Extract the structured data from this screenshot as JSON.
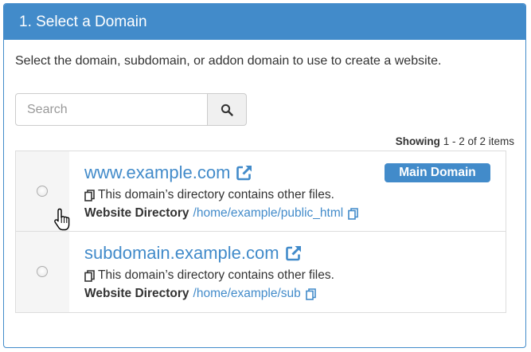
{
  "panel": {
    "title": "1. Select a Domain"
  },
  "description": "Select the domain, subdomain, or addon domain to use to create a website.",
  "search": {
    "placeholder": "Search",
    "value": ""
  },
  "pagination": {
    "showing_label": "Showing",
    "range_text": "1 - 2 of 2 items"
  },
  "domains": [
    {
      "name": "www.example.com",
      "badge": "Main Domain",
      "note": "This domain’s directory contains other files.",
      "dir_label": "Website Directory",
      "dir_path": "/home/example/public_html",
      "selected": false
    },
    {
      "name": "subdomain.example.com",
      "badge": "",
      "note": "This domain’s directory contains other files.",
      "dir_label": "Website Directory",
      "dir_path": "/home/example/sub",
      "selected": false
    }
  ],
  "icons": {
    "search": "search-icon",
    "external_link": "external-link-icon",
    "copy": "copy-icon",
    "cursor": "hand-pointer-cursor-icon"
  },
  "colors": {
    "primary": "#428bca",
    "border": "#dddddd",
    "radio_cell_bg": "#f5f5f5",
    "text": "#333333"
  }
}
